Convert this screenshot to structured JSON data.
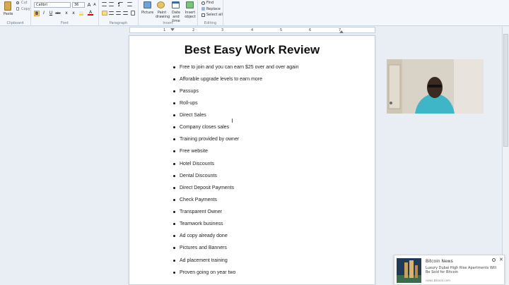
{
  "ribbon": {
    "clipboard": {
      "paste": "Paste",
      "cut": "Cut",
      "copy": "Copy",
      "label": "Clipboard"
    },
    "font": {
      "family": "Calibri",
      "size": "36",
      "grow": "A",
      "shrink": "A",
      "bold": "B",
      "italic": "I",
      "underline": "U",
      "strike": "abc",
      "sub": "x",
      "sup": "x",
      "color": "A",
      "label": "Font"
    },
    "paragraph": {
      "label": "Paragraph"
    },
    "insert": {
      "picture": "Picture",
      "paint_drawing": "Paint drawing",
      "date_time": "Date and time",
      "insert_object": "Insert object",
      "label": "Insert"
    },
    "editing": {
      "find": "Find",
      "replace": "Replace",
      "select_all": "Select all",
      "label": "Editing"
    }
  },
  "ruler": {
    "marks": [
      "1",
      "2",
      "3",
      "4",
      "5",
      "6",
      "7"
    ]
  },
  "document": {
    "title": "Best Easy Work Review",
    "items": [
      "Free to join and you can earn $25 over and over again",
      "Afforable upgrade levels to earn more",
      "Passups",
      "Roll-ups",
      "Direct Sales",
      "Company closes sales",
      "Training provided by owner",
      "Free website",
      "Hotel Discounts",
      "Dental Discounts",
      "Direct Deposit Payments",
      "Check Payments",
      "Transparent Owner",
      "Teamwork business",
      "Ad copy already done",
      "Pictures and Banners",
      "Ad placement training",
      "Proven going on year two"
    ]
  },
  "notification": {
    "source": "Bitcoin News",
    "headline": "Luxury Dubai High Rise Apartments Will Be Sold for Bitcoin",
    "domain": "news.bitcoin.com"
  },
  "colors": {
    "accent": "#3b6fb6",
    "ribbon": "#f3f6fb",
    "workspace": "#e9eef5"
  }
}
